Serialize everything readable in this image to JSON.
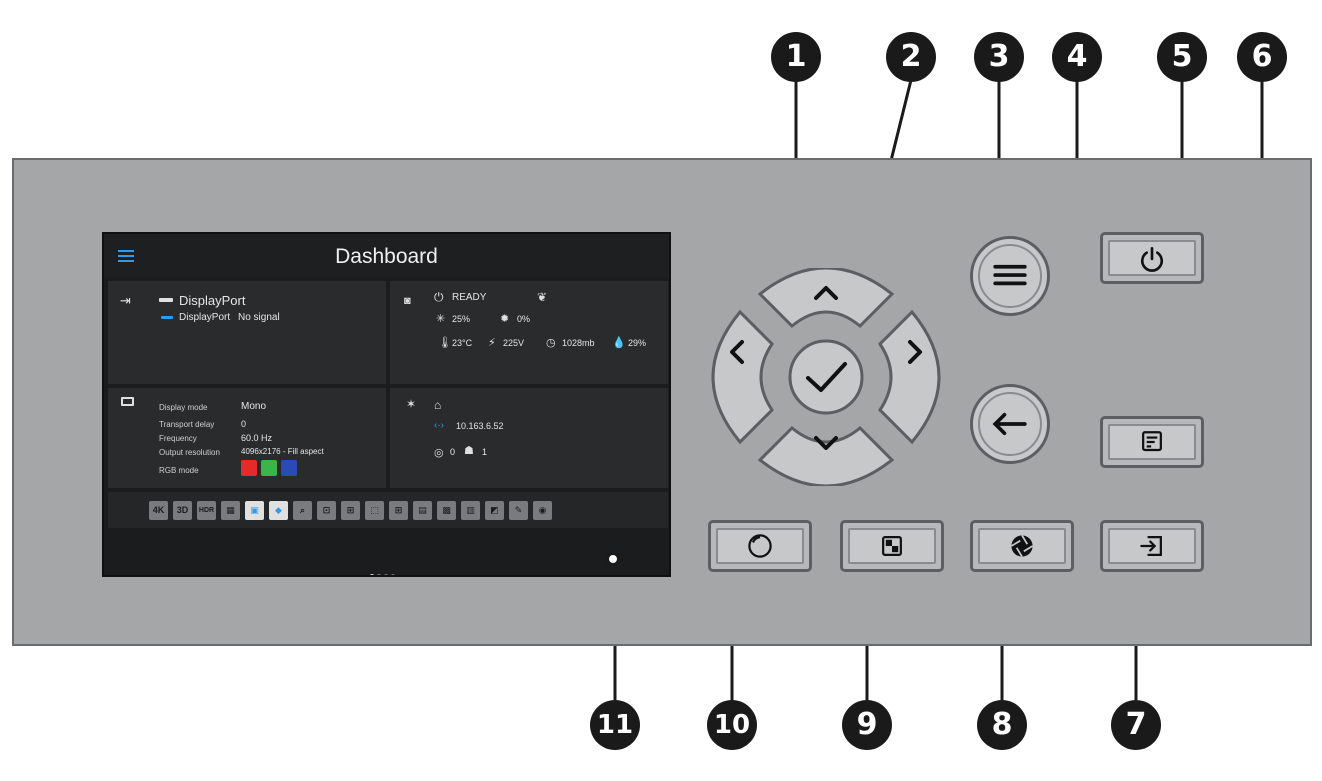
{
  "screen": {
    "title": "Dashboard",
    "input": {
      "source": "DisplayPort",
      "sub_source": "DisplayPort",
      "signal": "No signal"
    },
    "status": {
      "state": "READY",
      "light": "25%",
      "lamp": "0%",
      "temperature": "23°C",
      "voltage": "225V",
      "pressure": "1028mb",
      "humidity": "29%"
    },
    "display": {
      "rows": [
        {
          "label": "Display mode",
          "value": "Mono"
        },
        {
          "label": "Transport delay",
          "value": "0"
        },
        {
          "label": "Frequency",
          "value": "60.0 Hz"
        },
        {
          "label": "Output resolution",
          "value": "4096x2176 - Fill aspect"
        },
        {
          "label": "RGB mode",
          "value": ""
        }
      ],
      "rgb_colors": [
        "#e52a2a",
        "#39b54a",
        "#2a4bb5"
      ]
    },
    "network": {
      "ip": "10.163.6.52",
      "wifi_count": "0",
      "remote_count": "1"
    },
    "icon_row": [
      "4K",
      "3D",
      "HDR"
    ]
  },
  "callouts": [
    "1",
    "2",
    "3",
    "4",
    "5",
    "6",
    "7",
    "8",
    "9",
    "10",
    "11"
  ],
  "colors": {
    "accent": "#2f9be8",
    "panel": "#a5a6a8",
    "screen_bg": "#1b1c1e"
  }
}
